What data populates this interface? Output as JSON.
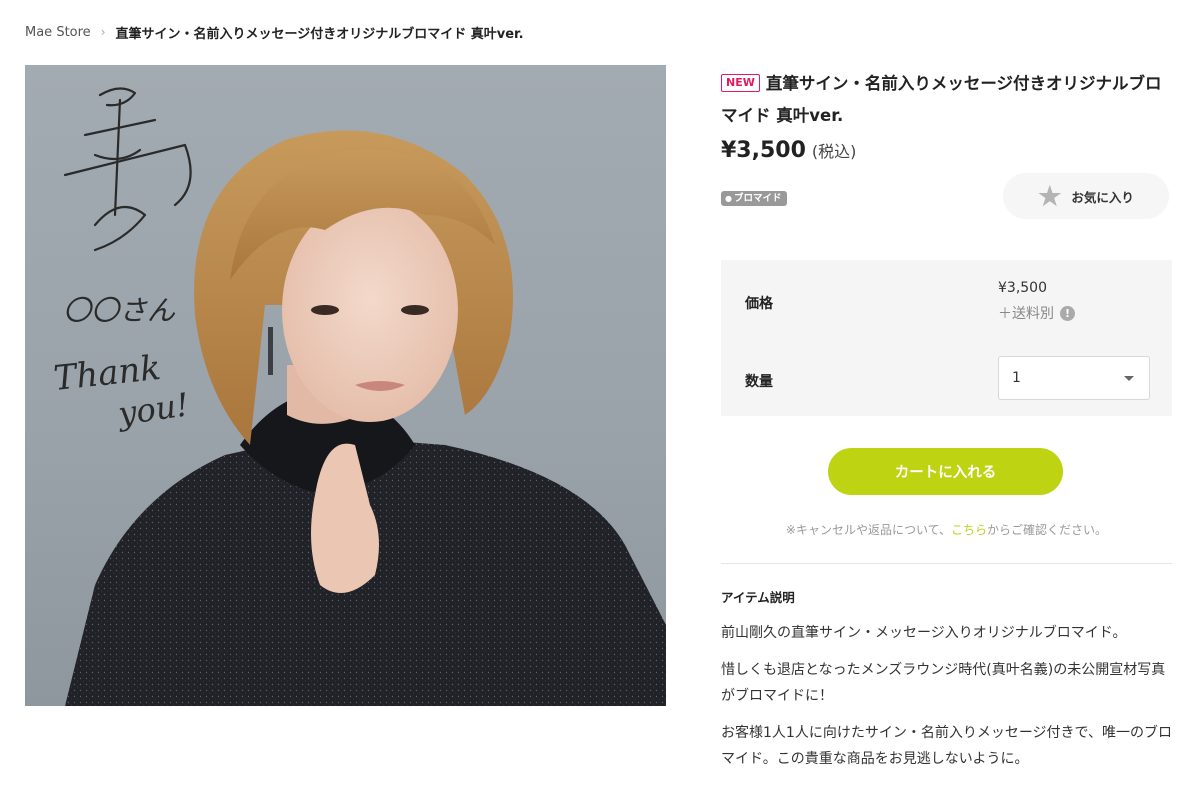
{
  "breadcrumb": {
    "store": "Mae Store",
    "separator": "›",
    "current": "直筆サイン・名前入りメッセージ付きオリジナルブロマイド 真叶ver."
  },
  "photo": {
    "description": "signed-portrait-photo",
    "handwriting_lines": [
      "〇〇さん",
      "Thank",
      "you!"
    ]
  },
  "product": {
    "badge": "NEW",
    "title": "直筆サイン・名前入りメッセージ付きオリジナルブロマイド 真叶ver.",
    "price": "¥3,500",
    "tax_note": "(税込)",
    "tag": "ブロマイド",
    "favorite_label": "お気に入り"
  },
  "order": {
    "price_label": "価格",
    "price_value": "¥3,500",
    "shipping_note": "＋送料別",
    "info_icon": "!",
    "quantity_label": "数量",
    "quantity_value": "1",
    "cart_label": "カートに入れる"
  },
  "notice": {
    "before": "※キャンセルや返品について、",
    "link": "こちら",
    "after": "からご確認ください。"
  },
  "description": {
    "heading": "アイテム説明",
    "paragraphs": [
      "前山剛久の直筆サイン・メッセージ入りオリジナルブロマイド。",
      "惜しくも退店となったメンズラウンジ時代(真叶名義)の未公開宣材写真がブロマイドに！",
      "お客様1人1人に向けたサイン・名前入りメッセージ付きで、唯一のブロマイド。この貴重な商品をお見逃しないように。"
    ]
  },
  "colors": {
    "accent_green": "#bed312",
    "badge_pink": "#e5195e",
    "panel_bg": "#f5f5f5"
  }
}
